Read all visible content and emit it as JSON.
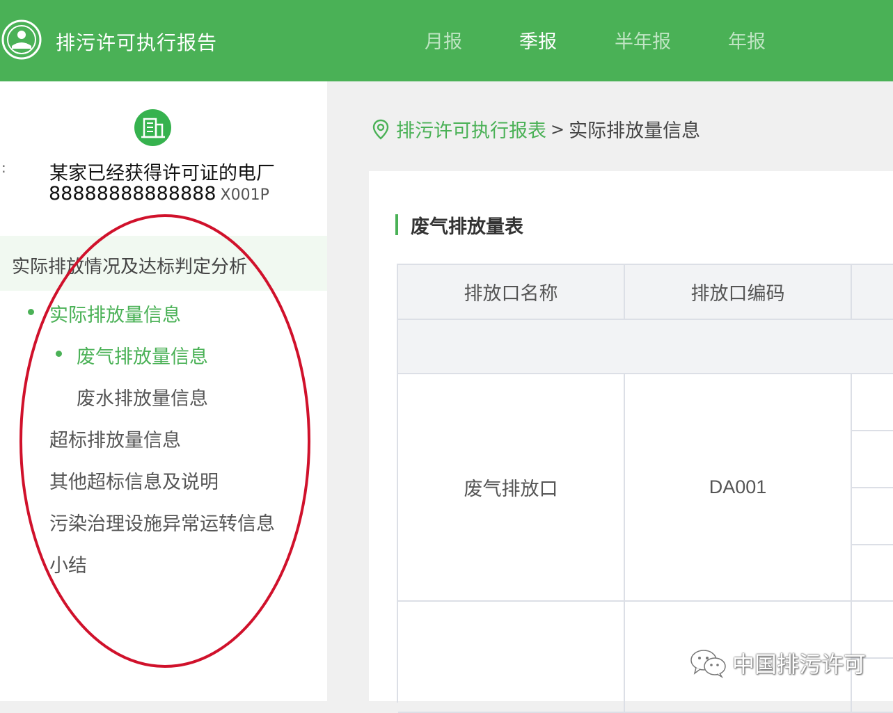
{
  "header": {
    "app_title": "排污许可执行报告",
    "tabs": [
      {
        "label": "月报",
        "active": false
      },
      {
        "label": "季报",
        "active": true
      },
      {
        "label": "半年报",
        "active": false
      },
      {
        "label": "年报",
        "active": false
      }
    ]
  },
  "sidebar": {
    "org_name": "某家已经获得许可证的电厂",
    "org_code": "88888888888888",
    "org_code_suffix": "X001P",
    "section_label": "实际排放情况及达标判定分析",
    "menu": [
      {
        "label": "实际排放量信息",
        "active": true
      },
      {
        "label": "废气排放量信息",
        "active": true
      },
      {
        "label": "废水排放量信息",
        "active": false
      },
      {
        "label": "超标排放量信息",
        "active": false
      },
      {
        "label": "其他超标信息及说明",
        "active": false
      },
      {
        "label": "污染治理设施异常运转信息",
        "active": false
      },
      {
        "label": "小结",
        "active": false
      }
    ]
  },
  "breadcrumb": {
    "link": "排污许可执行报表",
    "separator": ">",
    "current": "实际排放量信息"
  },
  "panel": {
    "title": "废气排放量表",
    "table": {
      "headers": [
        "排放口名称",
        "排放口编码"
      ],
      "rows": [
        {
          "name": "废气排放口",
          "code": "DA001"
        }
      ]
    }
  },
  "watermark": {
    "text": "中国排污许可"
  },
  "colors": {
    "accent": "#4ab156",
    "annotation": "#d0112b"
  }
}
